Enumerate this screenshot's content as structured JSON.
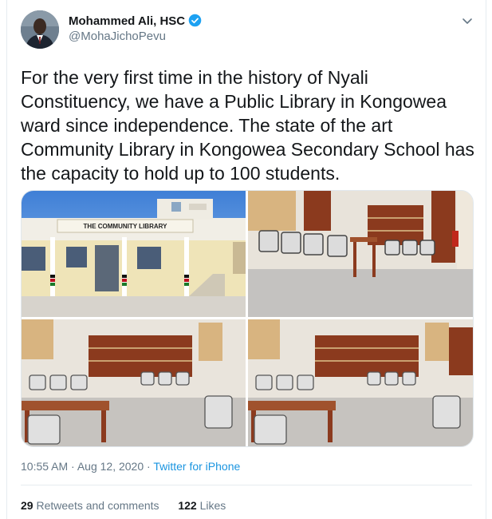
{
  "author": {
    "name": "Mohammed Ali, HSC",
    "handle": "@MohaJichoPevu"
  },
  "tweet": {
    "text": "For the very first time in the history of Nyali Constituency, we have a Public Library in Kongowea ward since independence. The state of the art Community Library in Kongowea Secondary School has the capacity to hold up to 100 students.",
    "photos": [
      {
        "name": "library-exterior-photo",
        "sign": "THE COMMUNITY LIBRARY"
      },
      {
        "name": "library-chairs-photo"
      },
      {
        "name": "library-hall-photo-1"
      },
      {
        "name": "library-hall-photo-2"
      }
    ]
  },
  "meta": {
    "time": "10:55 AM",
    "sep": " · ",
    "date": "Aug 12, 2020",
    "source": "Twitter for iPhone"
  },
  "stats": {
    "retweets_count": "29",
    "retweets_label": "Retweets and comments",
    "likes_count": "122",
    "likes_label": "Likes"
  },
  "colors": {
    "link": "#1b95e0",
    "verified": "#1da1f2",
    "secondary_text": "#657786"
  },
  "icons": [
    "verified-badge-icon",
    "chevron-down-icon"
  ]
}
